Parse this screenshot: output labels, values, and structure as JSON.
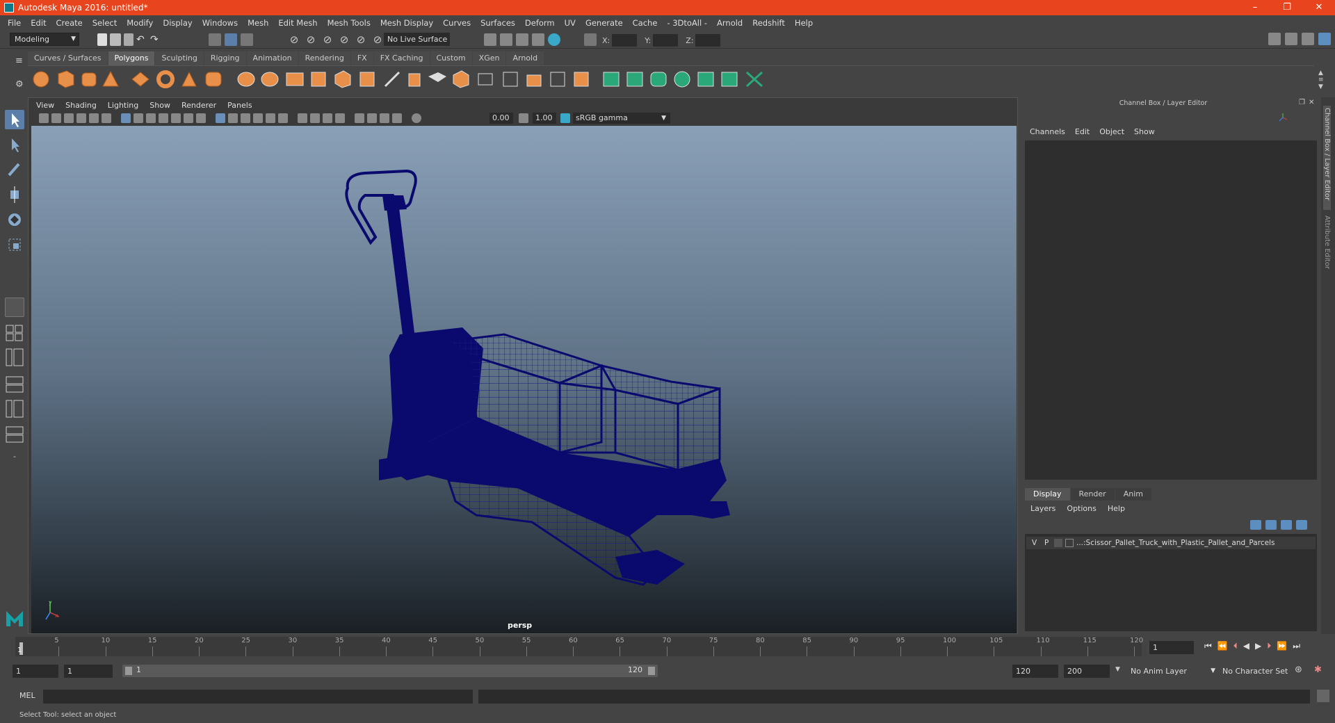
{
  "window": {
    "title": "Autodesk Maya 2016: untitled*",
    "controls": [
      "–",
      "❐",
      "✕"
    ]
  },
  "menubar": [
    "File",
    "Edit",
    "Create",
    "Select",
    "Modify",
    "Display",
    "Windows",
    "Mesh",
    "Edit Mesh",
    "Mesh Tools",
    "Mesh Display",
    "Curves",
    "Surfaces",
    "Deform",
    "UV",
    "Generate",
    "Cache",
    "- 3DtoAll -",
    "Arnold",
    "Redshift",
    "Help"
  ],
  "statusline": {
    "mode": "Modeling",
    "live_surface": "No Live Surface",
    "x_label": "X:",
    "y_label": "Y:",
    "z_label": "Z:"
  },
  "shelf_tabs": [
    "Curves / Surfaces",
    "Polygons",
    "Sculpting",
    "Rigging",
    "Animation",
    "Rendering",
    "FX",
    "FX Caching",
    "Custom",
    "XGen",
    "Arnold"
  ],
  "shelf_active": "Polygons",
  "viewport": {
    "menu": [
      "View",
      "Shading",
      "Lighting",
      "Show",
      "Renderer",
      "Panels"
    ],
    "exposure": "0.00",
    "gamma": "1.00",
    "color_space": "sRGB gamma",
    "camera_label": "persp",
    "model_color": "#0a0a6e"
  },
  "channel_box": {
    "title": "Channel Box / Layer Editor",
    "menu": [
      "Channels",
      "Edit",
      "Object",
      "Show"
    ]
  },
  "layer_editor": {
    "tabs": [
      "Display",
      "Render",
      "Anim"
    ],
    "active_tab": "Display",
    "menu": [
      "Layers",
      "Options",
      "Help"
    ],
    "layer": {
      "v": "V",
      "p": "P",
      "name": "...:Scissor_Pallet_Truck_with_Plastic_Pallet_and_Parcels"
    }
  },
  "side_tabs": [
    "Channel Box / Layer Editor",
    "Attribute Editor"
  ],
  "timeline": {
    "ticks": [
      "5",
      "10",
      "15",
      "20",
      "25",
      "30",
      "35",
      "40",
      "45",
      "50",
      "55",
      "60",
      "65",
      "70",
      "75",
      "80",
      "85",
      "90",
      "95",
      "100",
      "105",
      "110",
      "115",
      "120"
    ],
    "current_marker": "1",
    "current_frame": "1"
  },
  "range": {
    "start": "1",
    "start_inner": "1",
    "slider_start": "1",
    "slider_end": "120",
    "end_inner": "120",
    "end": "200",
    "anim_layer": "No Anim Layer",
    "character_set": "No Character Set"
  },
  "command_line": {
    "label": "MEL"
  },
  "help_line": "Select Tool: select an object"
}
